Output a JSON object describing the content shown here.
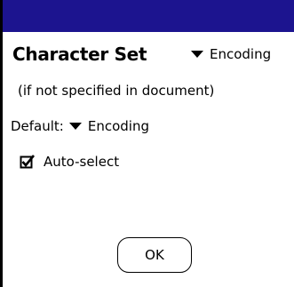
{
  "title_bar": {
    "color": "#1c148f"
  },
  "dialog": {
    "title": "Character Set",
    "encoding_label": "Encoding",
    "hint": "(if not specified in document)",
    "default_label": "Default:",
    "default_encoding_label": "Encoding",
    "auto_select": {
      "label": "Auto-select",
      "checked": true
    },
    "ok_label": "OK"
  },
  "icons": {
    "dropdown": "triangle-down-icon",
    "checkbox": "checkbox-checked-icon"
  }
}
